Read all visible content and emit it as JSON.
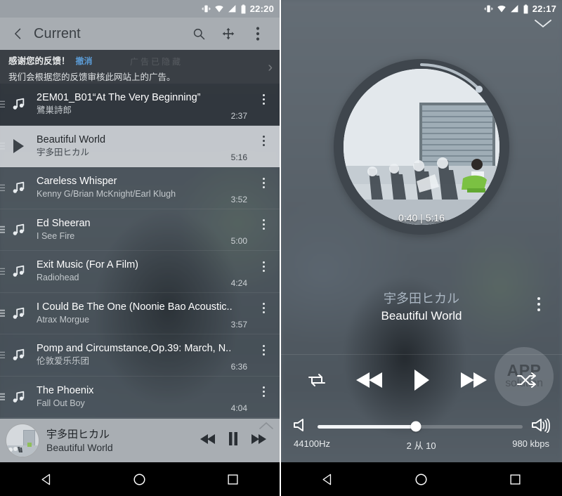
{
  "left": {
    "status_bar": {
      "time": "22:20",
      "icons": [
        "vibrate-icon",
        "wifi-icon",
        "signal-icon",
        "battery-icon"
      ]
    },
    "toolbar": {
      "title": "Current",
      "back_icon": "back-arrow-icon",
      "search_icon": "search-icon",
      "move_icon": "move-icon",
      "overflow_icon": "overflow-menu-icon"
    },
    "ad_banner": {
      "thanks": "感谢您的反馈！",
      "undo": "撤消",
      "body": "我们会根据您的反馈审核此网站上的广告。",
      "ghost": "广告已隐藏",
      "chevron": "›"
    },
    "tracks": [
      {
        "title": "2EM01_B01“At The Very Beginning”",
        "artist": "鷺巣詩郎",
        "duration": "2:37",
        "state": "dark",
        "icon": "music-note-icon"
      },
      {
        "title": "Beautiful World",
        "artist": "宇多田ヒカル",
        "duration": "5:16",
        "state": "active",
        "icon": "play-icon"
      },
      {
        "title": "Careless Whisper",
        "artist": "Kenny G/Brian McKnight/Earl Klugh",
        "duration": "3:52",
        "state": "normal",
        "icon": "music-note-icon"
      },
      {
        "title": "Ed Sheeran",
        "artist": "I See Fire",
        "duration": "5:00",
        "state": "normal",
        "icon": "music-note-icon"
      },
      {
        "title": "Exit Music (For A Film)",
        "artist": "Radiohead",
        "duration": "4:24",
        "state": "normal",
        "icon": "music-note-icon"
      },
      {
        "title": "I Could Be The One (Noonie Bao Acoustic..",
        "artist": "Atrax Morgue",
        "duration": "3:57",
        "state": "normal",
        "icon": "music-note-icon"
      },
      {
        "title": "Pomp and Circumstance,Op.39: March, N..",
        "artist": "伦敦爱乐乐团",
        "duration": "6:36",
        "state": "normal",
        "icon": "music-note-icon"
      },
      {
        "title": "The Phoenix",
        "artist": "Fall Out Boy",
        "duration": "4:04",
        "state": "normal",
        "icon": "music-note-icon"
      }
    ],
    "mini_player": {
      "artist": "宇多田ヒカル",
      "title": "Beautiful World",
      "prev_icon": "rewind-icon",
      "pause_icon": "pause-icon",
      "next_icon": "fast-forward-icon",
      "expand_icon": "chevron-up-icon"
    }
  },
  "right": {
    "status_bar": {
      "time": "22:17",
      "icons": [
        "vibrate-icon",
        "wifi-icon",
        "signal-icon",
        "battery-icon"
      ]
    },
    "collapse_icon": "chevron-down-icon",
    "album_art": {
      "elapsed_total": "0:40 | 5:16",
      "progress_percent": 13
    },
    "now_playing": {
      "artist": "宇多田ヒカル",
      "title": "Beautiful World",
      "overflow_icon": "overflow-menu-icon"
    },
    "controls": {
      "repeat_icon": "repeat-icon",
      "prev_icon": "rewind-icon",
      "play_icon": "play-icon",
      "next_icon": "fast-forward-icon",
      "shuffle_icon": "shuffle-icon"
    },
    "watermark": {
      "line1": "APP",
      "line2": "solution"
    },
    "volume": {
      "mute_icon": "volume-low-icon",
      "loud_icon": "volume-high-icon",
      "level_percent": 48
    },
    "meta": {
      "sample_rate": "44100Hz",
      "position": "2 从 10",
      "bitrate": "980 kbps"
    }
  },
  "navbar": {
    "back_icon": "nav-back-icon",
    "home_icon": "nav-home-icon",
    "recents_icon": "nav-recents-icon"
  },
  "colors": {
    "accent_link": "#5b9bd5",
    "toolbar_bg": "#a8adb2",
    "status_bg": "#9aa0a6",
    "banner_bg": "#3a3f45",
    "active_row": "#e4e7ea"
  }
}
